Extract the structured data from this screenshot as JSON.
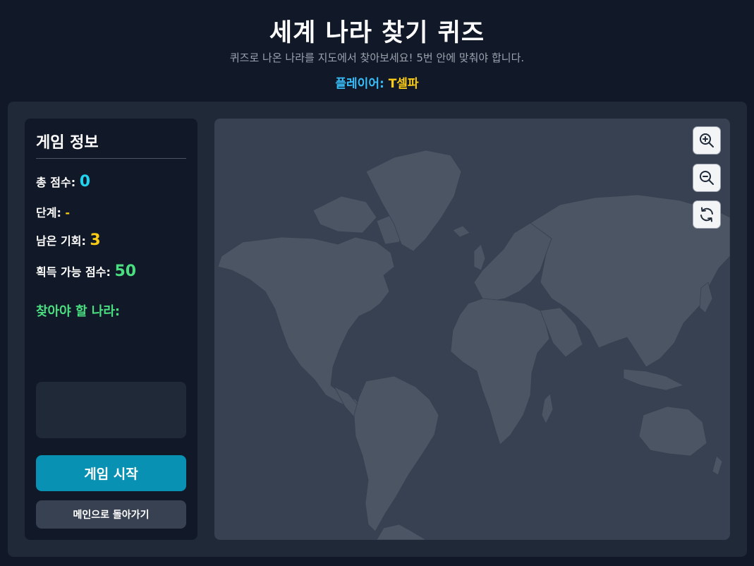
{
  "header": {
    "title": "세계 나라 찾기 퀴즈",
    "subtitle": "퀴즈로 나온 나라를 지도에서 찾아보세요! 5번 안에 맞춰야 합니다.",
    "player_label": "플레이어: ",
    "player_name": "T셀파"
  },
  "panel": {
    "title": "게임 정보",
    "total_score_label": "총 점수: ",
    "total_score": "0",
    "stage_label": "단계: ",
    "stage": "-",
    "chances_label": "남은 기회: ",
    "chances": "3",
    "available_label": "획득 가능 점수: ",
    "available_score": "50",
    "target_label": "찾아야 할 나라:",
    "target_country": "",
    "message": "",
    "start_button": "게임 시작",
    "main_button": "메인으로 돌아가기"
  },
  "map": {
    "controls": [
      "zoom-in-icon",
      "zoom-out-icon",
      "reset-icon"
    ]
  },
  "colors": {
    "background": "#111827",
    "panel": "#1f2937",
    "map": "#374151",
    "land": "#4b5563",
    "accent": "#0891b2",
    "cyan": "#22d3ee",
    "yellow": "#facc15",
    "green": "#4ade80"
  }
}
